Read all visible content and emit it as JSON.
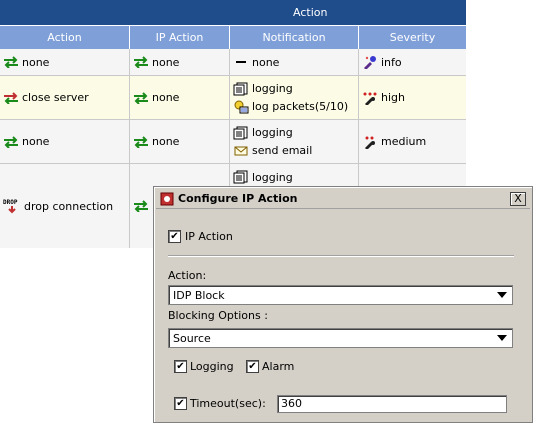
{
  "table": {
    "super_header": "Action",
    "columns": [
      "Action",
      "IP Action",
      "Notification",
      "Severity"
    ],
    "rows": [
      {
        "action": {
          "label": "none",
          "icon": "none-arrows-icon"
        },
        "ip_action": {
          "label": "none",
          "icon": "none-arrows-icon"
        },
        "notification": [
          {
            "label": "none",
            "icon": "dash-icon"
          }
        ],
        "severity": {
          "label": "info",
          "icon": "info-severity-icon"
        }
      },
      {
        "action": {
          "label": "close server",
          "icon": "close-server-icon"
        },
        "ip_action": {
          "label": "none",
          "icon": "none-arrows-icon"
        },
        "notification": [
          {
            "label": "logging",
            "icon": "logging-icon"
          },
          {
            "label": "log packets(5/10)",
            "icon": "log-packets-icon"
          }
        ],
        "severity": {
          "label": "high",
          "icon": "high-severity-icon"
        }
      },
      {
        "action": {
          "label": "none",
          "icon": "none-arrows-icon"
        },
        "ip_action": {
          "label": "none",
          "icon": "none-arrows-icon"
        },
        "notification": [
          {
            "label": "logging",
            "icon": "logging-icon"
          },
          {
            "label": "send email",
            "icon": "email-icon"
          }
        ],
        "severity": {
          "label": "medium",
          "icon": "medium-severity-icon"
        }
      },
      {
        "action": {
          "label": "drop connection",
          "icon": "drop-icon",
          "icon_text": "DROP"
        },
        "ip_action": {
          "label": "",
          "icon": "none-arrows-icon"
        },
        "notification": [
          {
            "label": "logging",
            "icon": "logging-icon"
          }
        ],
        "severity": {
          "label": "",
          "icon": ""
        }
      }
    ]
  },
  "dialog": {
    "title": "Configure IP Action",
    "close_glyph": "X",
    "ip_action_checkbox": {
      "label": "IP Action",
      "checked": true
    },
    "action_label": "Action:",
    "action_value": "IDP Block",
    "blocking_label": "Blocking Options :",
    "blocking_value": "Source",
    "logging": {
      "label": "Logging",
      "checked": true
    },
    "alarm": {
      "label": "Alarm",
      "checked": true
    },
    "timeout": {
      "label": "Timeout(sec):",
      "checked": true,
      "value": "360"
    },
    "check_glyph": "✔"
  },
  "colors": {
    "header_dark": "#1f4d8c",
    "header_light": "#7f9fd9",
    "row_highlight": "#fbfbe6",
    "dialog_bg": "#d4d0c8"
  }
}
